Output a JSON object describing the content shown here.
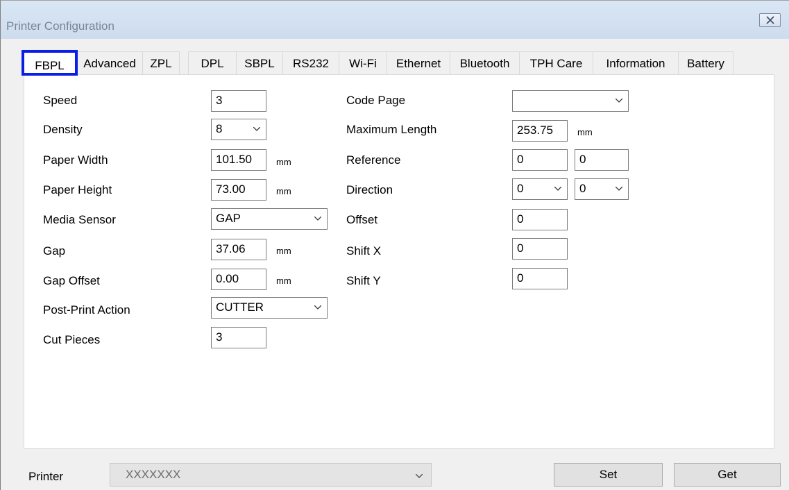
{
  "window": {
    "title": "Printer Configuration"
  },
  "tabs": [
    {
      "label": "FBPL",
      "active": true
    },
    {
      "label": "Advanced"
    },
    {
      "label": "ZPL"
    },
    {
      "label": "DPL"
    },
    {
      "label": "SBPL"
    },
    {
      "label": "RS232"
    },
    {
      "label": "Wi-Fi"
    },
    {
      "label": "Ethernet"
    },
    {
      "label": "Bluetooth"
    },
    {
      "label": "TPH Care"
    },
    {
      "label": "Information"
    },
    {
      "label": "Battery"
    }
  ],
  "left": {
    "speed": {
      "label": "Speed",
      "value": "3"
    },
    "density": {
      "label": "Density",
      "value": "8"
    },
    "paper_width": {
      "label": "Paper Width",
      "value": "101.50",
      "unit": "mm"
    },
    "paper_height": {
      "label": "Paper Height",
      "value": "73.00",
      "unit": "mm"
    },
    "media_sensor": {
      "label": "Media Sensor",
      "value": "GAP"
    },
    "gap": {
      "label": "Gap",
      "value": "37.06",
      "unit": "mm"
    },
    "gap_offset": {
      "label": "Gap Offset",
      "value": "0.00",
      "unit": "mm"
    },
    "post_print_action": {
      "label": "Post-Print Action",
      "value": "CUTTER"
    },
    "cut_pieces": {
      "label": "Cut Pieces",
      "value": "3"
    }
  },
  "right": {
    "code_page": {
      "label": "Code Page",
      "value": ""
    },
    "maximum_length": {
      "label": "Maximum Length",
      "value": "253.75",
      "unit": "mm"
    },
    "reference": {
      "label": "Reference",
      "x": "0",
      "y": "0"
    },
    "direction": {
      "label": "Direction",
      "a": "0",
      "b": "0"
    },
    "offset": {
      "label": "Offset",
      "value": "0"
    },
    "shift_x": {
      "label": "Shift X",
      "value": "0"
    },
    "shift_y": {
      "label": "Shift Y",
      "value": "0"
    }
  },
  "bottom": {
    "printer_label": "Printer",
    "printer_value": "XXXXXXX",
    "set_label": "Set",
    "get_label": "Get"
  },
  "colors": {
    "active_tab_highlight": "#0a1ee6",
    "title_bar": "#d3e1f2"
  }
}
